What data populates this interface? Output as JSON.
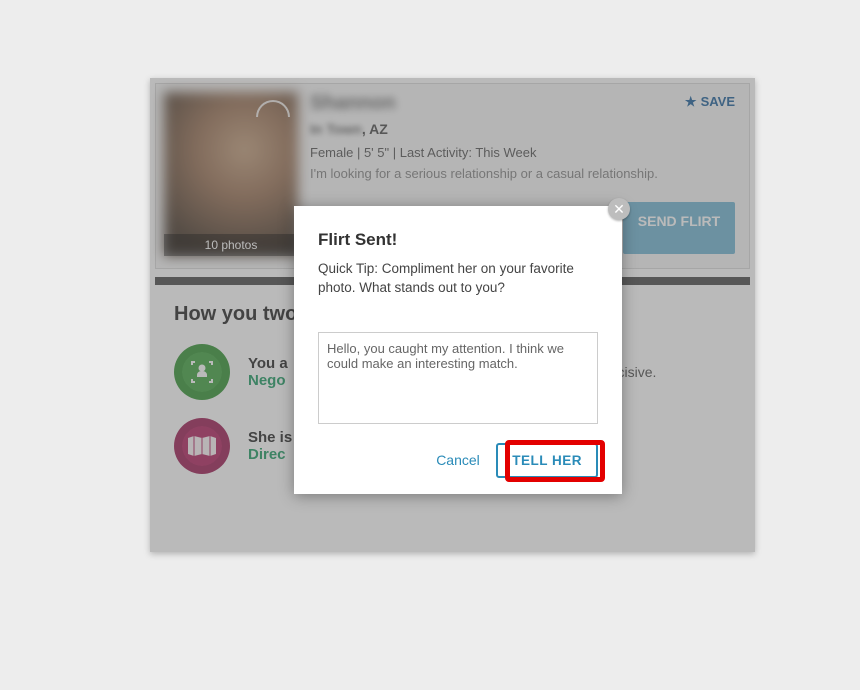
{
  "profile": {
    "name_blurred": "Shannon",
    "location_blurred_prefix": "In Town",
    "location_suffix": ", AZ",
    "stats": "Female | 5' 5\" | Last Activity: This Week",
    "bio": "I'm looking for a serious relationship or a casual relationship.",
    "photo_count": "10 photos",
    "save_label": "SAVE",
    "send_flirt_label": "SEND FLIRT"
  },
  "compare": {
    "heading": "How you two",
    "you": {
      "line1": "You a",
      "line2": "Nego"
    },
    "her": {
      "line1": "She is",
      "line2": "Direc"
    },
    "desc_fragment": "ectors ill have nake otiator cisive."
  },
  "modal": {
    "title": "Flirt Sent!",
    "tip": "Quick Tip: Compliment her on your favorite photo. What stands out to you?",
    "message": "Hello, you caught my attention. I think we could make an interesting match.",
    "cancel_label": "Cancel",
    "submit_label": "TELL HER"
  }
}
